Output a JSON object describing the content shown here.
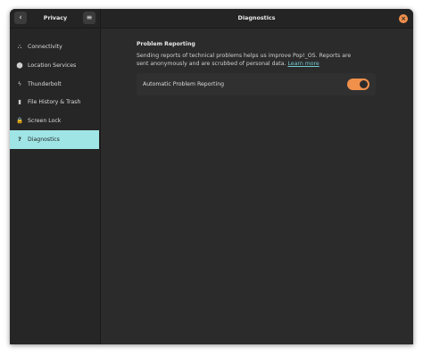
{
  "header": {
    "sidebar_title": "Privacy",
    "main_title": "Diagnostics",
    "back_icon": "‹",
    "menu_icon": "≡",
    "close_icon": "×"
  },
  "sidebar": {
    "items": [
      {
        "label": "Connectivity",
        "icon": "connectivity-icon",
        "glyph": "⛬",
        "selected": false
      },
      {
        "label": "Location Services",
        "icon": "location-pin-icon",
        "glyph": "⬤",
        "selected": false
      },
      {
        "label": "Thunderbolt",
        "icon": "thunderbolt-icon",
        "glyph": "ϟ",
        "selected": false
      },
      {
        "label": "File History & Trash",
        "icon": "file-history-icon",
        "glyph": "▮",
        "selected": false
      },
      {
        "label": "Screen Lock",
        "icon": "lock-icon",
        "glyph": "🔒",
        "selected": false
      },
      {
        "label": "Diagnostics",
        "icon": "question-icon",
        "glyph": "?",
        "selected": true
      }
    ]
  },
  "main": {
    "section_title": "Problem Reporting",
    "description": "Sending reports of technical problems helps us improve Pop!_OS. Reports are sent anonymously and are scrubbed of personal data.",
    "learn_more": "Learn more",
    "row_label": "Automatic Problem Reporting",
    "toggle_on": true
  },
  "colors": {
    "accent": "#f1904b",
    "selected_bg": "#9fe5e6",
    "link": "#73c8cf"
  }
}
